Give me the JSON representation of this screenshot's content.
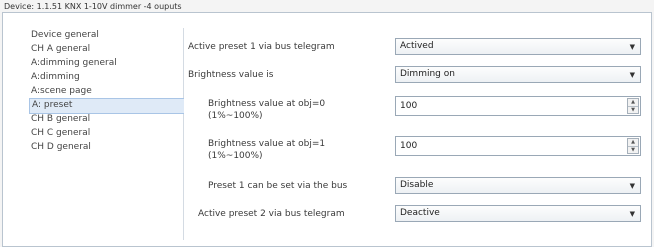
{
  "window": {
    "title": "Device: 1.1.51  KNX 1-10V dimmer -4 ouputs"
  },
  "sidebar": {
    "items": [
      {
        "label": "Device general",
        "selected": false
      },
      {
        "label": "CH A general",
        "selected": false
      },
      {
        "label": "A:dimming general",
        "selected": false
      },
      {
        "label": "A:dimming",
        "selected": false
      },
      {
        "label": "A:scene page",
        "selected": false
      },
      {
        "label": "A: preset",
        "selected": true
      },
      {
        "label": "CH B general",
        "selected": false
      },
      {
        "label": "CH C general",
        "selected": false
      },
      {
        "label": "CH D general",
        "selected": false
      }
    ]
  },
  "params": {
    "active_preset1": {
      "label": "Active preset 1 via bus telegram",
      "value": "Actived"
    },
    "brightness_value": {
      "label": "Brightness value is",
      "value": "Dimming on"
    },
    "brightness_obj0": {
      "label_line1": "Brightness value at obj=0",
      "label_line2": "(1%~100%)",
      "value": "100"
    },
    "brightness_obj1": {
      "label_line1": "Brightness value at obj=1",
      "label_line2": "(1%~100%)",
      "value": "100"
    },
    "preset1_set": {
      "label": "Preset 1 can be set via the bus",
      "value": "Disable"
    },
    "active_preset2": {
      "label": "Active preset 2 via bus telegram",
      "value": "Deactive"
    }
  },
  "icons": {
    "dropdown": "chevron-down-icon",
    "spin_up": "arrow-up-icon",
    "spin_down": "arrow-down-icon"
  }
}
